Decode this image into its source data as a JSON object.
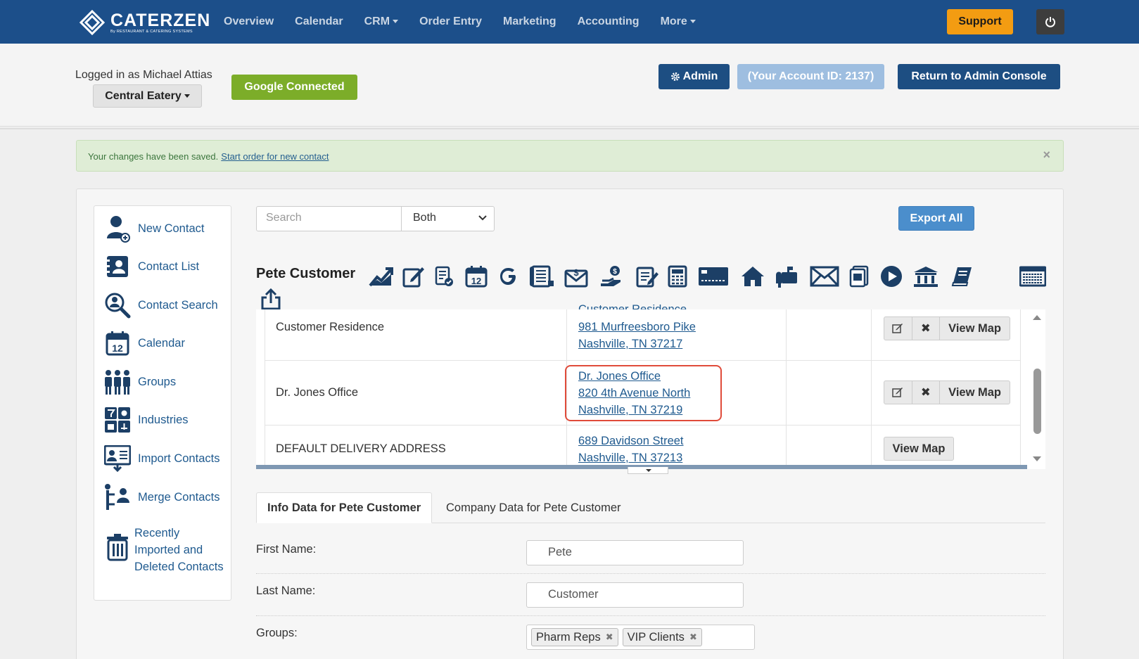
{
  "brand": {
    "name": "CATERZEN",
    "tagline": "By RESTAURANT & CATERING SYSTEMS"
  },
  "nav": {
    "items": [
      {
        "label": "Overview",
        "dropdown": false
      },
      {
        "label": "Calendar",
        "dropdown": false
      },
      {
        "label": "CRM",
        "dropdown": true
      },
      {
        "label": "Order Entry",
        "dropdown": false
      },
      {
        "label": "Marketing",
        "dropdown": false
      },
      {
        "label": "Accounting",
        "dropdown": false
      },
      {
        "label": "More",
        "dropdown": true
      }
    ],
    "support_label": "Support",
    "power_icon": "power-icon"
  },
  "header": {
    "logged_in_text": "Logged in as Michael Attias",
    "venue_label": "Central Eatery",
    "google_label": "Google Connected",
    "admin_label": "Admin",
    "account_label": "(Your Account ID: 2137)",
    "return_label": "Return to Admin Console"
  },
  "alert": {
    "message": "Your changes have been saved.",
    "link_text": "Start order for new contact",
    "close": "×"
  },
  "sidebar": {
    "items": [
      {
        "label": "New Contact",
        "icon": "new-contact-icon"
      },
      {
        "label": "Contact List",
        "icon": "contact-list-icon"
      },
      {
        "label": "Contact Search",
        "icon": "contact-search-icon"
      },
      {
        "label": "Calendar",
        "icon": "calendar-icon"
      },
      {
        "label": "Groups",
        "icon": "groups-icon"
      },
      {
        "label": "Industries",
        "icon": "industries-icon"
      },
      {
        "label": "Import Contacts",
        "icon": "import-contacts-icon"
      },
      {
        "label": "Merge Contacts",
        "icon": "merge-contacts-icon"
      },
      {
        "label_lines": [
          "Recently",
          "Imported and",
          "Deleted Contacts"
        ],
        "icon": "trash-icon"
      }
    ]
  },
  "search": {
    "placeholder": "Search",
    "filter_value": "Both",
    "export_label": "Export All"
  },
  "contact": {
    "name": "Pete Customer"
  },
  "toolbar_icons": [
    "chart-icon",
    "edit-note-icon",
    "checklist-icon",
    "calendar-12-icon",
    "google-icon",
    "ledger-icon",
    "envelope-dollar-icon",
    "payment-icon",
    "document-edit-icon",
    "calculator-icon",
    "card-icon",
    "home-icon",
    "mailbox-icon",
    "mail-icon",
    "document-stack-icon",
    "play-icon",
    "bank-icon",
    "book-icon",
    "keyboard-icon",
    "share-icon"
  ],
  "addresses": {
    "rows": [
      {
        "label": "Customer Residence",
        "lines": [
          "Customer Residence",
          "981 Murfreesboro Pike",
          "Nashville, TN 37217"
        ],
        "actions": [
          "edit",
          "delete",
          "View Map"
        ]
      },
      {
        "label": "Dr. Jones Office",
        "lines": [
          "Dr. Jones Office",
          "820 4th Avenue North",
          "Nashville, TN 37219"
        ],
        "actions": [
          "edit",
          "delete",
          "View Map"
        ]
      },
      {
        "label": "DEFAULT DELIVERY ADDRESS",
        "lines": [
          "689 Davidson Street",
          "Nashville, TN 37213"
        ],
        "actions": [
          "View Map"
        ]
      }
    ],
    "view_map_label": "View Map",
    "delete_glyph": "✖"
  },
  "tabs": [
    {
      "label": "Info Data for Pete Customer",
      "active": true
    },
    {
      "label": "Company Data for Pete Customer",
      "active": false
    }
  ],
  "form": {
    "first_name_label": "First Name:",
    "first_name_value": "Pete",
    "last_name_label": "Last Name:",
    "last_name_value": "Customer",
    "groups_label": "Groups:",
    "groups": [
      "Pharm Reps",
      "VIP Clients"
    ],
    "tag_remove": "✖"
  }
}
